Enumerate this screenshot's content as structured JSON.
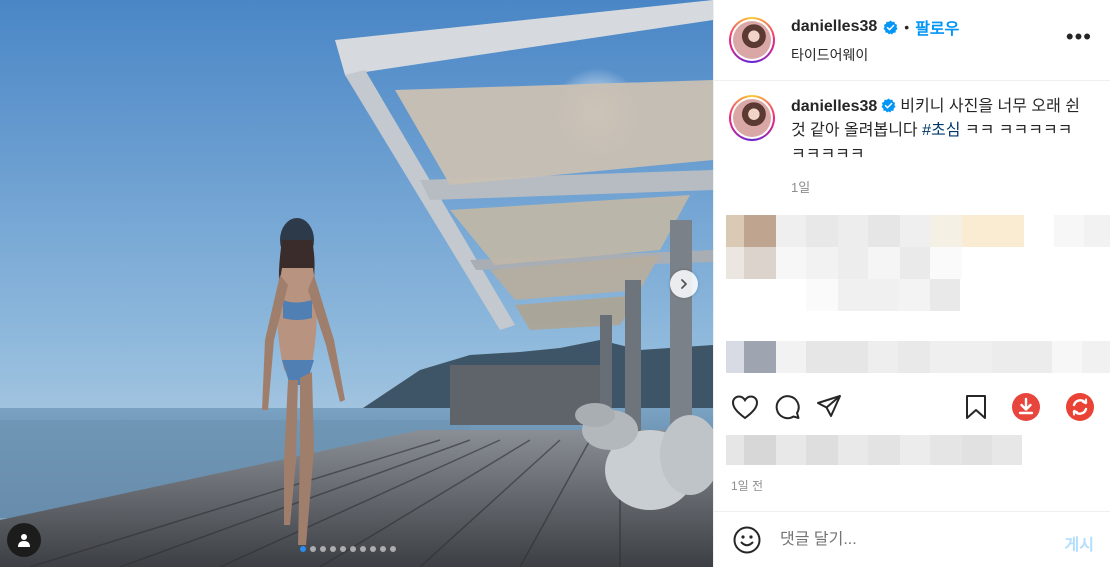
{
  "post": {
    "username": "danielles38",
    "follow_label": "팔로우",
    "bullet": "•",
    "location": "타이드어웨이",
    "more_label": "•••"
  },
  "caption": {
    "username": "danielles38",
    "text": "비키니 사진을 너무 오래 쉰 것 같아 올려봅니다",
    "hashtag": "#초심",
    "tail": "ㅋㅋ ㅋㅋㅋㅋㅋㅋㅋㅋㅋㅋ",
    "time": "1일"
  },
  "footer": {
    "time_ago": "1일 전",
    "comment_placeholder": "댓글 달기...",
    "post_label": "게시"
  },
  "carousel": {
    "count": 10,
    "active_index": 0
  },
  "colors": {
    "accent": "#0095f6",
    "hashtag": "#00376b",
    "download_red": "#e8453c",
    "refresh_red": "#ea4335"
  },
  "icons": [
    "verified-icon",
    "more-icon",
    "chevron-right-icon",
    "user-tag-icon",
    "heart-icon",
    "comment-icon",
    "share-icon",
    "bookmark-icon",
    "download-icon",
    "refresh-icon",
    "emoji-icon"
  ]
}
